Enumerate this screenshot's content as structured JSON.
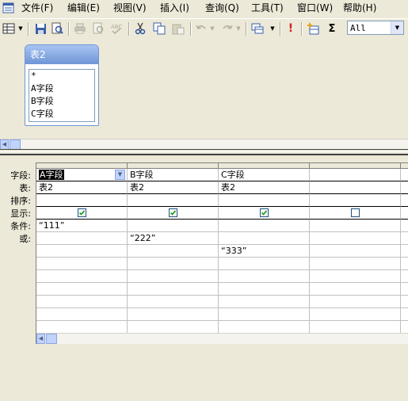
{
  "menu": {
    "items": [
      "文件(F)",
      "编辑(E)",
      "视图(V)",
      "插入(I)",
      "查询(Q)",
      "工具(T)",
      "窗口(W)",
      "帮助(H)"
    ]
  },
  "toolbar": {
    "icons": [
      "view-icon",
      "save-icon",
      "print-preview-icon",
      "print-icon",
      "preview-icon",
      "spelling-icon",
      "cut-icon",
      "copy-icon",
      "paste-icon",
      "undo-icon",
      "redo-icon",
      "query-type-icon",
      "run-icon",
      "show-table-icon",
      "totals-icon"
    ],
    "run_symbol": "!",
    "totals_symbol": "Σ",
    "top_values": "All"
  },
  "field_list": {
    "title": "表2",
    "fields": [
      "*",
      "A字段",
      "B字段",
      "C字段"
    ]
  },
  "grid": {
    "row_labels": [
      "字段:",
      "表:",
      "排序:",
      "显示:",
      "条件:",
      "或:"
    ],
    "columns": [
      {
        "field": "A字段",
        "table": "表2",
        "sort": "",
        "show": true,
        "criteria": "“111”",
        "or": "",
        "or2": ""
      },
      {
        "field": "B字段",
        "table": "表2",
        "sort": "",
        "show": true,
        "criteria": "",
        "or": "“222”",
        "or2": ""
      },
      {
        "field": "C字段",
        "table": "表2",
        "sort": "",
        "show": true,
        "criteria": "",
        "or": "",
        "or2": "“333”"
      },
      {
        "field": "",
        "table": "",
        "sort": "",
        "show": false,
        "criteria": "",
        "or": "",
        "or2": ""
      }
    ]
  },
  "colors": {
    "window_bg": "#ece9d8",
    "field_list_title": "#6f95d6",
    "checkbox_green": "#21a121"
  }
}
